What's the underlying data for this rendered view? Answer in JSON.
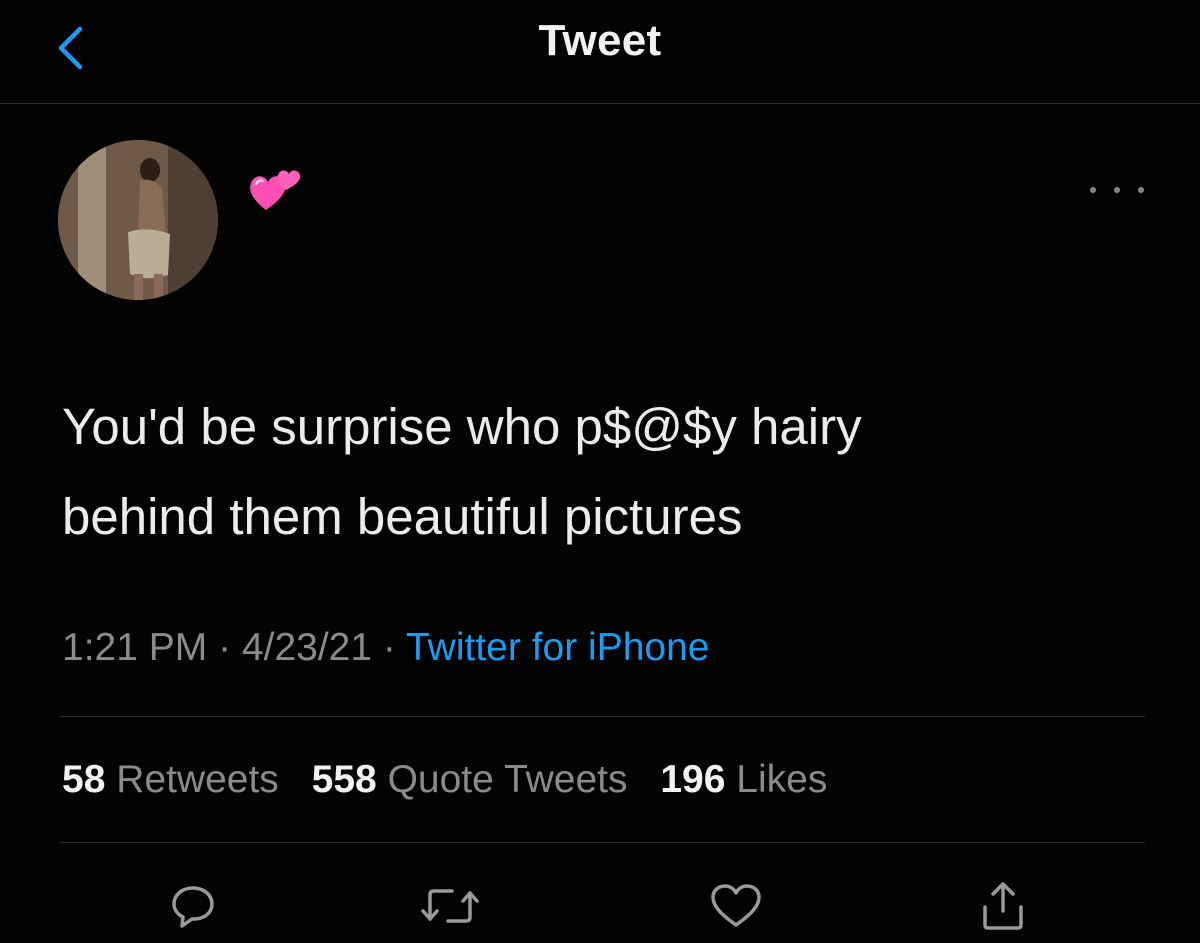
{
  "header": {
    "title": "Tweet",
    "back_icon": "chevron-left-icon"
  },
  "author": {
    "emoji_icon": "two-hearts-icon",
    "more_icon": "ellipsis-icon"
  },
  "tweet": {
    "line1": "You'd be surprise who p$@$y hairy",
    "line2": "behind them beautiful pictures"
  },
  "meta": {
    "time": "1:21 PM",
    "sep1": " · ",
    "date": "4/23/21",
    "sep2": " · ",
    "source": "Twitter for iPhone"
  },
  "stats": {
    "retweets_count": "58",
    "retweets_label": "Retweets",
    "quotes_count": "558",
    "quotes_label": "Quote Tweets",
    "likes_count": "196",
    "likes_label": "Likes"
  },
  "actions": [
    "reply-icon",
    "retweet-icon",
    "like-icon",
    "share-icon"
  ],
  "colors": {
    "background": "#030303",
    "link": "#1d9bf0",
    "muted": "#8b8b8b",
    "heart": "#ff4fb3"
  }
}
